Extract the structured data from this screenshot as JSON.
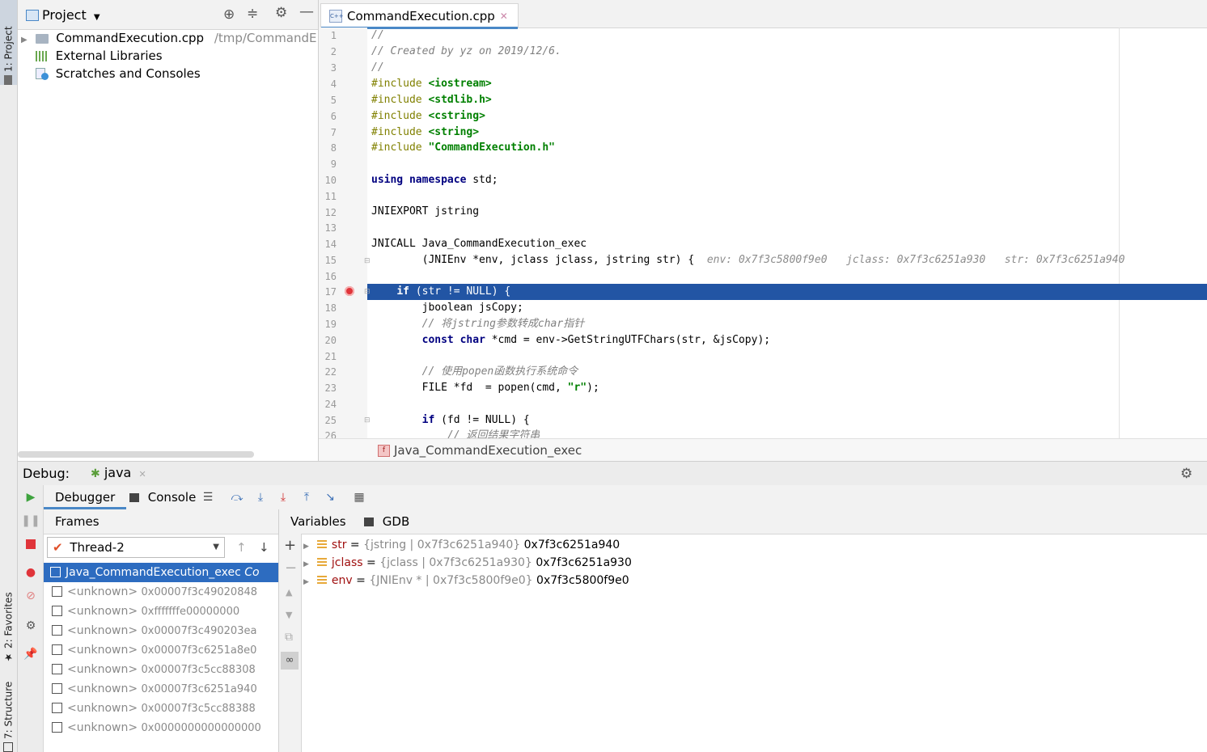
{
  "sidebar_tabs": {
    "project": "1: Project",
    "favorites": "2: Favorites",
    "structure": "7: Structure"
  },
  "project": {
    "title": "Project",
    "items": [
      {
        "label": "CommandExecution.cpp",
        "path": "/tmp/CommandE"
      },
      {
        "label": "External Libraries"
      },
      {
        "label": "Scratches and Consoles"
      }
    ]
  },
  "editor": {
    "tab_label": "CommandExecution.cpp",
    "line_numbers": [
      "1",
      "2",
      "3",
      "4",
      "5",
      "6",
      "7",
      "8",
      "9",
      "10",
      "11",
      "12",
      "13",
      "14",
      "15",
      "16",
      "17",
      "18",
      "19",
      "20",
      "21",
      "22",
      "23",
      "24",
      "25",
      "26"
    ],
    "inline_hints": {
      "env": "env: 0x7f3c5800f9e0",
      "jclass": "jclass: 0x7f3c6251a930",
      "str": "str: 0x7f3c6251a940"
    },
    "breadcrumb": "Java_CommandExecution_exec"
  },
  "debug": {
    "label": "Debug:",
    "session_tab": "java",
    "tabs": {
      "debugger": "Debugger",
      "console": "Console"
    },
    "frames_title": "Frames",
    "thread": "Thread-2",
    "frames": [
      {
        "name": "Java_CommandExecution_exec",
        "suffix": "Co"
      },
      {
        "name": "<unknown>",
        "addr": "0x00007f3c49020848"
      },
      {
        "name": "<unknown>",
        "addr": "0xfffffffe00000000"
      },
      {
        "name": "<unknown>",
        "addr": "0x00007f3c490203ea"
      },
      {
        "name": "<unknown>",
        "addr": "0x00007f3c6251a8e0"
      },
      {
        "name": "<unknown>",
        "addr": "0x00007f3c5cc88308"
      },
      {
        "name": "<unknown>",
        "addr": "0x00007f3c6251a940"
      },
      {
        "name": "<unknown>",
        "addr": "0x00007f3c5cc88388"
      },
      {
        "name": "<unknown>",
        "addr": "0x0000000000000000"
      }
    ],
    "vars_tabs": {
      "variables": "Variables",
      "gdb": "GDB"
    },
    "variables": [
      {
        "name": "str",
        "type": "{jstring | 0x7f3c6251a940}",
        "value": "0x7f3c6251a940"
      },
      {
        "name": "jclass",
        "type": "{jclass | 0x7f3c6251a930}",
        "value": "0x7f3c6251a930"
      },
      {
        "name": "env",
        "type": "{JNIEnv * | 0x7f3c5800f9e0}",
        "value": "0x7f3c5800f9e0"
      }
    ]
  },
  "colors": {
    "selection": "#2255a4",
    "keyword": "#000080",
    "string": "#008000",
    "comment": "#808080",
    "accent": "#4a88c7"
  },
  "icons": [
    "gear-icon",
    "minimize-icon",
    "target-icon",
    "collapse-icon",
    "resume-icon",
    "pause-icon",
    "stop-icon",
    "breakpoint-icon",
    "step-over-icon",
    "step-into-icon",
    "step-out-icon",
    "add-icon",
    "remove-icon",
    "up-arrow-icon",
    "down-arrow-icon"
  ]
}
